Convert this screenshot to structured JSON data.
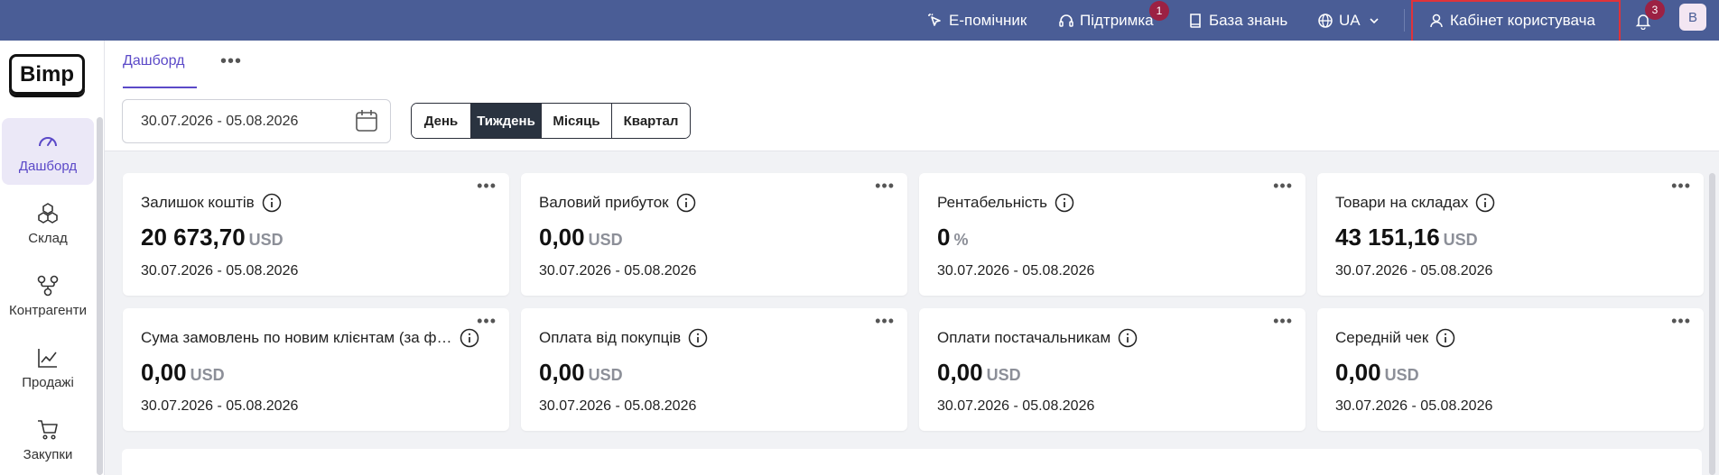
{
  "topbar": {
    "assistant_label": "Е-помічник",
    "support_label": "Підтримка",
    "support_badge": "1",
    "knowledge_label": "База знань",
    "language_label": "UA",
    "account_label": "Кабінет користувача",
    "notifications_badge": "3",
    "avatar_letter": "B"
  },
  "logo_text": "Bimp",
  "sidebar": {
    "items": [
      {
        "label": "Дашборд",
        "icon": "gauge-icon"
      },
      {
        "label": "Склад",
        "icon": "boxes-icon"
      },
      {
        "label": "Контрагенти",
        "icon": "network-icon"
      },
      {
        "label": "Продажі",
        "icon": "chart-line-icon"
      },
      {
        "label": "Закупки",
        "icon": "cart-icon"
      }
    ]
  },
  "tabs": {
    "active_label": "Дашборд",
    "more_label": "•••"
  },
  "filters": {
    "date_range": "30.07.2026 - 05.08.2026",
    "periods": [
      "День",
      "Тиждень",
      "Місяць",
      "Квартал"
    ],
    "selected_period": "Тиждень"
  },
  "cards": [
    {
      "title": "Залишок коштів",
      "value": "20 673,70",
      "unit": "USD",
      "date": "30.07.2026 - 05.08.2026"
    },
    {
      "title": "Валовий прибуток",
      "value": "0,00",
      "unit": "USD",
      "date": "30.07.2026 - 05.08.2026"
    },
    {
      "title": "Рентабельність",
      "value": "0",
      "unit": "%",
      "date": "30.07.2026 - 05.08.2026"
    },
    {
      "title": "Товари на складах",
      "value": "43 151,16",
      "unit": "USD",
      "date": "30.07.2026 - 05.08.2026"
    },
    {
      "title": "Сума замовлень по новим клієнтам (за філ…",
      "value": "0,00",
      "unit": "USD",
      "date": "30.07.2026 - 05.08.2026"
    },
    {
      "title": "Оплата від покупців",
      "value": "0,00",
      "unit": "USD",
      "date": "30.07.2026 - 05.08.2026"
    },
    {
      "title": "Оплати постачальникам",
      "value": "0,00",
      "unit": "USD",
      "date": "30.07.2026 - 05.08.2026"
    },
    {
      "title": "Середній чек",
      "value": "0,00",
      "unit": "USD",
      "date": "30.07.2026 - 05.08.2026"
    }
  ],
  "colors": {
    "topbar": "#4a5d96",
    "accent": "#5b49c8",
    "badge": "#9c2143",
    "annotation": "#e0333a"
  }
}
